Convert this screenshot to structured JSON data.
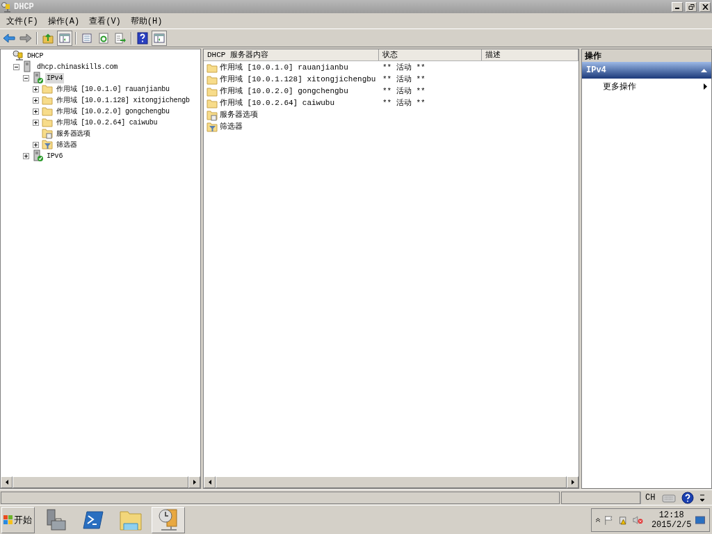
{
  "window": {
    "title": "DHCP"
  },
  "menu": [
    "文件(F)",
    "操作(A)",
    "查看(V)",
    "帮助(H)"
  ],
  "toolbar": [
    {
      "kind": "back",
      "pressed": false
    },
    {
      "kind": "forward",
      "pressed": false
    },
    {
      "kind": "sep"
    },
    {
      "kind": "up",
      "pressed": false
    },
    {
      "kind": "pane",
      "pressed": true
    },
    {
      "kind": "sep"
    },
    {
      "kind": "props",
      "pressed": false
    },
    {
      "kind": "refresh",
      "pressed": false
    },
    {
      "kind": "export",
      "pressed": false
    },
    {
      "kind": "sep"
    },
    {
      "kind": "help",
      "pressed": false
    },
    {
      "kind": "pane",
      "pressed": true
    }
  ],
  "tree": [
    {
      "label": "DHCP",
      "kind": "root",
      "selected": false,
      "children": [
        {
          "label": "dhcp.chinaskills.com",
          "kind": "server",
          "selected": false,
          "expanded": true,
          "children": [
            {
              "label": "IPv4",
              "kind": "ip",
              "selected": true,
              "expanded": true,
              "children": [
                {
                  "label": "作用域 [10.0.1.0] rauanjianbu",
                  "kind": "folder",
                  "selected": false,
                  "expanded": false
                },
                {
                  "label": "作用域 [10.0.1.128] xitongjichengb",
                  "kind": "folder",
                  "selected": false,
                  "expanded": false
                },
                {
                  "label": "作用域 [10.0.2.0] gongchengbu",
                  "kind": "folder",
                  "selected": false,
                  "expanded": false
                },
                {
                  "label": "作用域 [10.0.2.64] caiwubu",
                  "kind": "folder",
                  "selected": false,
                  "expanded": false
                },
                {
                  "label": "服务器选项",
                  "kind": "options",
                  "selected": false
                },
                {
                  "label": "筛选器",
                  "kind": "filter",
                  "selected": false,
                  "expanded": false
                }
              ]
            },
            {
              "label": "IPv6",
              "kind": "ip",
              "selected": false,
              "expanded": false
            }
          ]
        }
      ]
    }
  ],
  "list": {
    "columns": [
      "DHCP 服务器内容",
      "状态",
      "描述"
    ],
    "rows": [
      {
        "name": "作用域 [10.0.1.0] rauanjianbu",
        "kind": "folder",
        "status": "** 活动 **"
      },
      {
        "name": "作用域 [10.0.1.128] xitongjichengbu",
        "kind": "folder",
        "status": "** 活动 **"
      },
      {
        "name": "作用域 [10.0.2.0] gongchengbu",
        "kind": "folder",
        "status": "** 活动 **"
      },
      {
        "name": "作用域 [10.0.2.64] caiwubu",
        "kind": "folder",
        "status": "** 活动 **"
      },
      {
        "name": "服务器选项",
        "kind": "options"
      },
      {
        "name": "筛选器",
        "kind": "filter"
      }
    ]
  },
  "actions": {
    "title": "操作",
    "section": "IPv4",
    "expanded": true,
    "items": [
      "更多操作"
    ]
  },
  "language_bar": {
    "language": "CH"
  },
  "taskbar": {
    "start": "开始",
    "apps": [
      {
        "kind": "server-manager",
        "active": false
      },
      {
        "kind": "powershell",
        "active": false
      },
      {
        "kind": "explorer",
        "active": false
      },
      {
        "kind": "dhcp",
        "active": true
      }
    ],
    "clock": {
      "time": "12:18",
      "date": "2015/2/5"
    }
  }
}
